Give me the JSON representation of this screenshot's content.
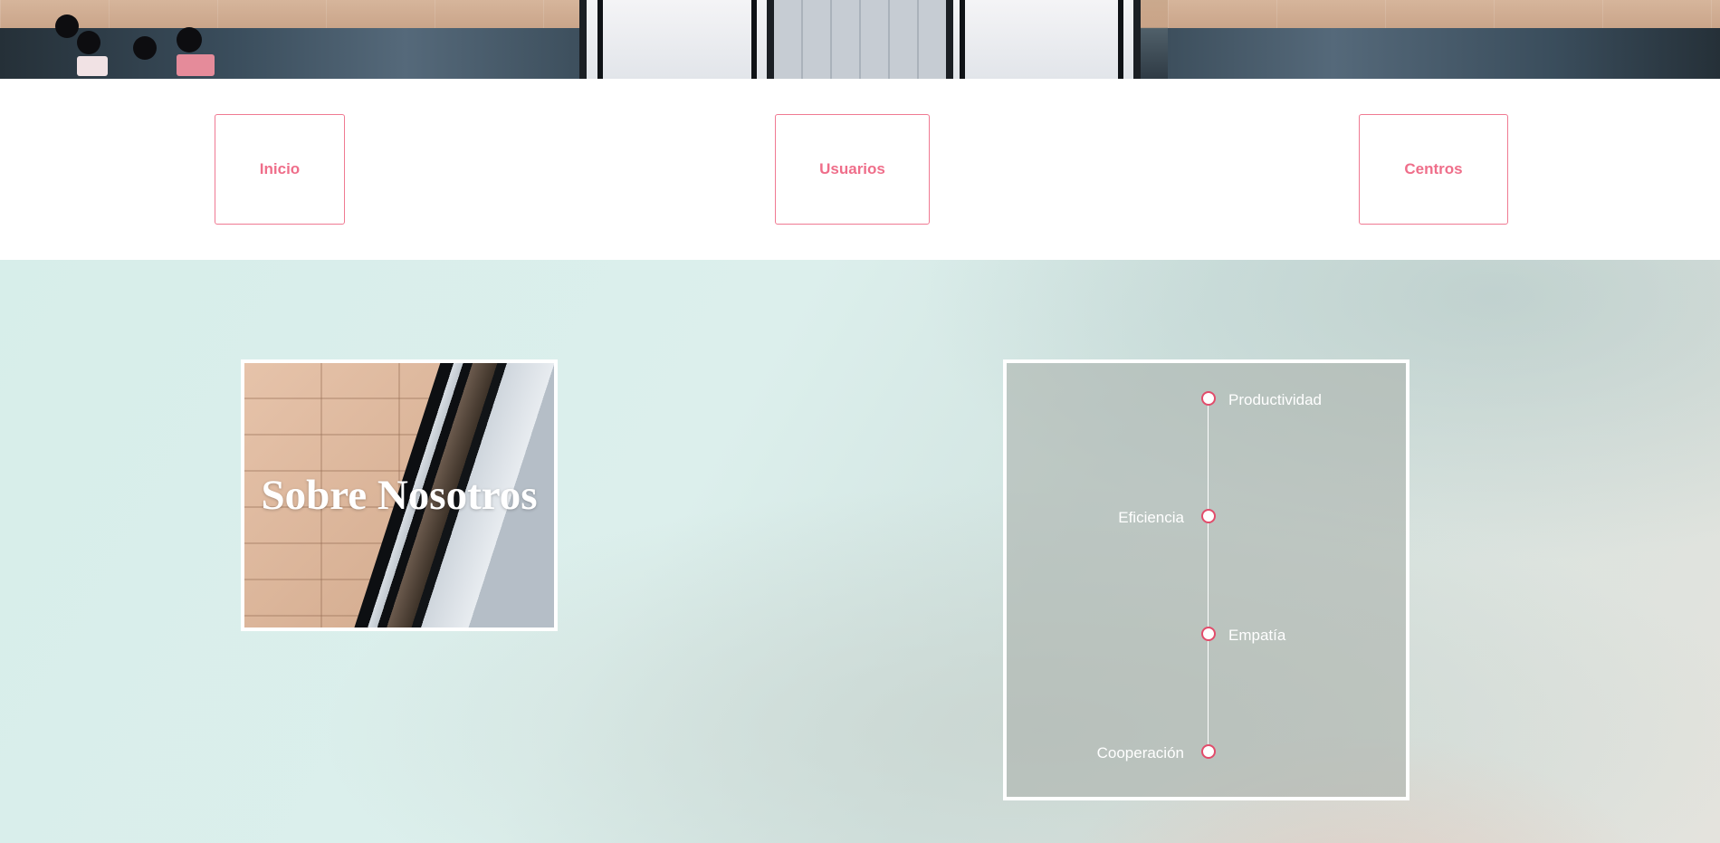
{
  "nav": {
    "items": [
      {
        "label": "Inicio"
      },
      {
        "label": "Usuarios"
      },
      {
        "label": "Centros"
      }
    ]
  },
  "about": {
    "title": "Sobre Nosotros"
  },
  "values": {
    "items": [
      {
        "label": "Productividad",
        "side": "right"
      },
      {
        "label": "Eficiencia",
        "side": "left"
      },
      {
        "label": "Empatía",
        "side": "right"
      },
      {
        "label": "Cooperación",
        "side": "left"
      }
    ]
  },
  "colors": {
    "accent": "#ef6e8a",
    "nav_border": "#f07a92",
    "timeline_dot_border": "#e24c6b",
    "section_bg": "#d7eeea"
  }
}
